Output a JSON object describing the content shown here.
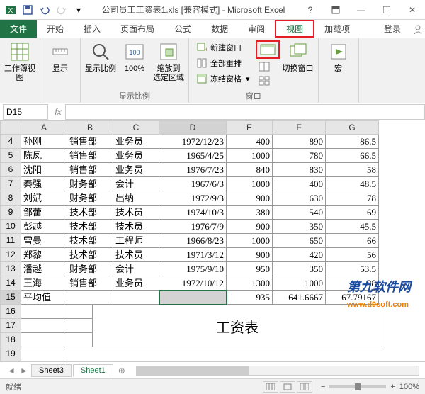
{
  "title": "公司员工工资表1.xls [兼容模式] - Microsoft Excel",
  "tabs": {
    "file": "文件",
    "home": "开始",
    "insert": "插入",
    "layout": "页面布局",
    "formulas": "公式",
    "data": "数据",
    "review": "审阅",
    "view": "视图",
    "addins": "加载项",
    "login": "登录"
  },
  "ribbon": {
    "workbook_views": "工作簿视图",
    "show": "显示",
    "zoom": "显示比例",
    "zoom100": "100%",
    "zoom_selection": "缩放到\n选定区域",
    "new_window": "新建窗口",
    "arrange_all": "全部重排",
    "freeze_panes": "冻结窗格",
    "window_group": "窗口",
    "switch_window": "切换窗口",
    "macros": "宏"
  },
  "name_box": "D15",
  "columns": [
    "A",
    "B",
    "C",
    "D",
    "E",
    "F",
    "G"
  ],
  "rows": [
    {
      "n": 4,
      "a": "孙刚",
      "b": "销售部",
      "c": "业务员",
      "d": "1972/12/23",
      "e": "400",
      "f": "890",
      "g": "86.5"
    },
    {
      "n": 5,
      "a": "陈凤",
      "b": "销售部",
      "c": "业务员",
      "d": "1965/4/25",
      "e": "1000",
      "f": "780",
      "g": "66.5"
    },
    {
      "n": 6,
      "a": "沈阳",
      "b": "销售部",
      "c": "业务员",
      "d": "1976/7/23",
      "e": "840",
      "f": "830",
      "g": "58"
    },
    {
      "n": 7,
      "a": "秦强",
      "b": "财务部",
      "c": "会计",
      "d": "1967/6/3",
      "e": "1000",
      "f": "400",
      "g": "48.5"
    },
    {
      "n": 8,
      "a": "刘斌",
      "b": "财务部",
      "c": "出纳",
      "d": "1972/9/3",
      "e": "900",
      "f": "630",
      "g": "78"
    },
    {
      "n": 9,
      "a": "邹蕾",
      "b": "技术部",
      "c": "技术员",
      "d": "1974/10/3",
      "e": "380",
      "f": "540",
      "g": "69"
    },
    {
      "n": 10,
      "a": "彭越",
      "b": "技术部",
      "c": "技术员",
      "d": "1976/7/9",
      "e": "900",
      "f": "350",
      "g": "45.5"
    },
    {
      "n": 11,
      "a": "雷曼",
      "b": "技术部",
      "c": "工程师",
      "d": "1966/8/23",
      "e": "1000",
      "f": "650",
      "g": "66"
    },
    {
      "n": 12,
      "a": "郑黎",
      "b": "技术部",
      "c": "技术员",
      "d": "1971/3/12",
      "e": "900",
      "f": "420",
      "g": "56"
    },
    {
      "n": 13,
      "a": "潘越",
      "b": "财务部",
      "c": "会计",
      "d": "1975/9/10",
      "e": "950",
      "f": "350",
      "g": "53.5"
    },
    {
      "n": 14,
      "a": "王海",
      "b": "销售部",
      "c": "业务员",
      "d": "1972/10/12",
      "e": "1300",
      "f": "1000",
      "g": "88"
    },
    {
      "n": 15,
      "a": "平均值",
      "b": "",
      "c": "",
      "d": "",
      "e": "935",
      "f": "641.6667",
      "g": "67.79167"
    }
  ],
  "empty_rows": [
    16,
    17,
    18,
    19
  ],
  "footer_title": "工资表",
  "sheet_tabs": {
    "sheet3": "Sheet3",
    "sheet1": "Sheet1"
  },
  "status": {
    "ready": "就绪",
    "zoom": "100%"
  },
  "watermark": "第九软件网",
  "watermark_url": "www.d9soft.com"
}
